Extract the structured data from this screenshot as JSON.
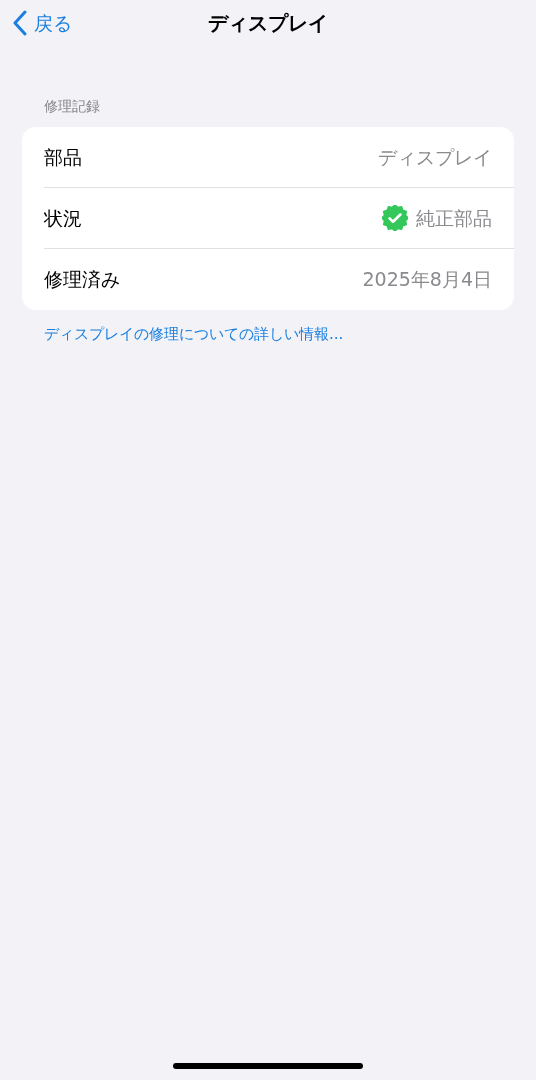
{
  "nav": {
    "back": "戻る",
    "title": "ディスプレイ"
  },
  "section": {
    "header": "修理記録",
    "rows": [
      {
        "kind": "text",
        "label": "部品",
        "value": "ディスプレイ"
      },
      {
        "kind": "verified",
        "label": "状況",
        "value": "純正部品"
      },
      {
        "kind": "text",
        "label": "修理済み",
        "value": "2025年8月4日"
      }
    ]
  },
  "link": "ディスプレイの修理についての詳しい情報..."
}
